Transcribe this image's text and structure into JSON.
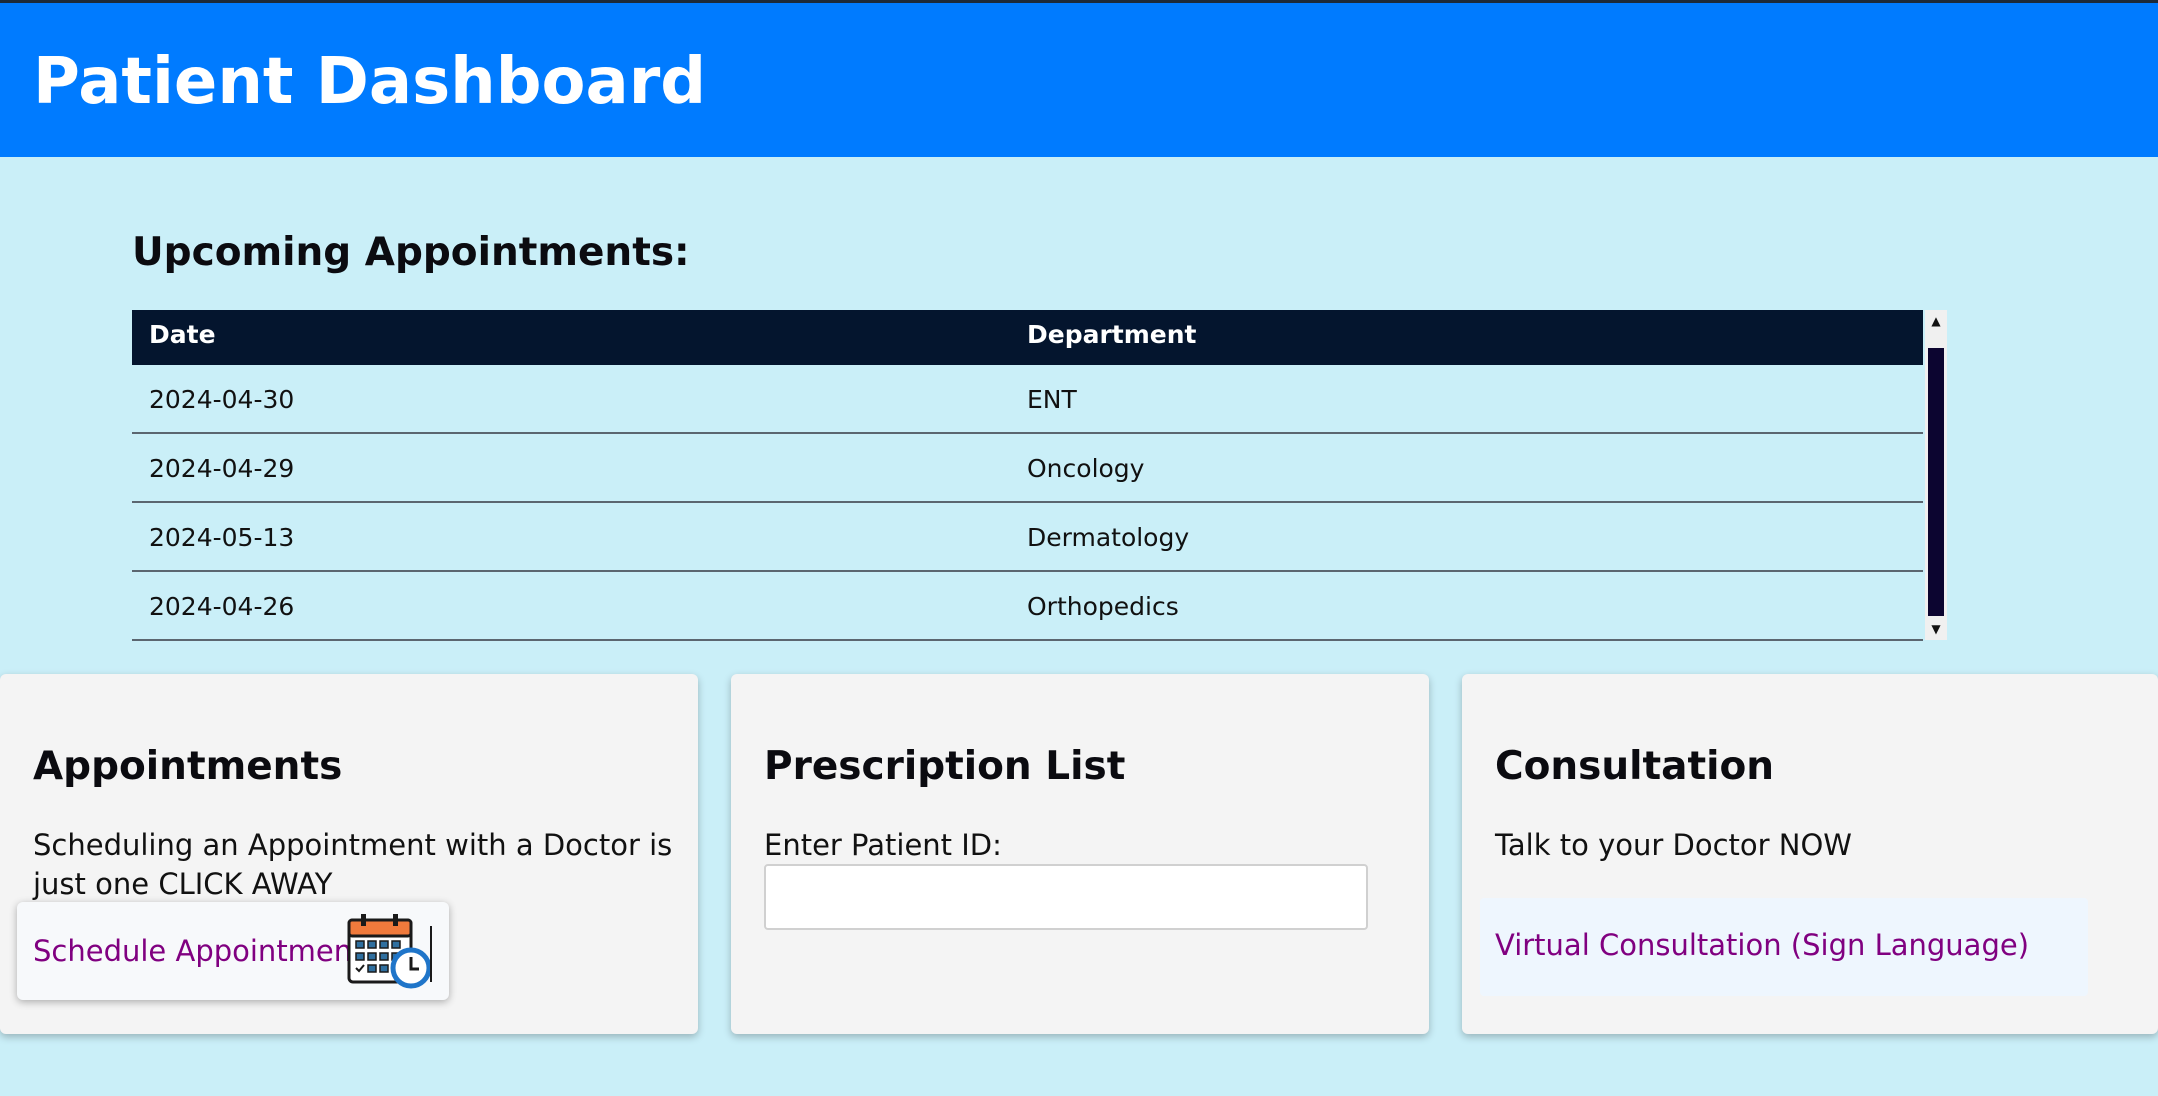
{
  "header": {
    "title": "Patient Dashboard"
  },
  "appointments_section": {
    "title": "Upcoming Appointments:",
    "columns": [
      "Date",
      "Department"
    ],
    "rows": [
      {
        "date": "2024-04-30",
        "department": "ENT"
      },
      {
        "date": "2024-04-29",
        "department": "Oncology"
      },
      {
        "date": "2024-05-13",
        "department": "Dermatology"
      },
      {
        "date": "2024-04-26",
        "department": "Orthopedics"
      }
    ]
  },
  "cards": {
    "appointments": {
      "title": "Appointments",
      "description": "Scheduling an Appointment with a Doctor is just one CLICK AWAY",
      "button_label": "Schedule Appointment",
      "button_icon": "calendar-clock-icon"
    },
    "prescriptions": {
      "title": "Prescription List",
      "input_label": "Enter Patient ID:",
      "input_value": ""
    },
    "consultation": {
      "title": "Consultation",
      "description": "Talk to your Doctor NOW",
      "link_label": "Virtual Consultation (Sign Language)"
    }
  },
  "colors": {
    "header_bg": "#007bff",
    "page_bg": "#caeff8",
    "table_head_bg": "#04152e",
    "link": "#800080",
    "card_bg": "#f4f4f4"
  }
}
